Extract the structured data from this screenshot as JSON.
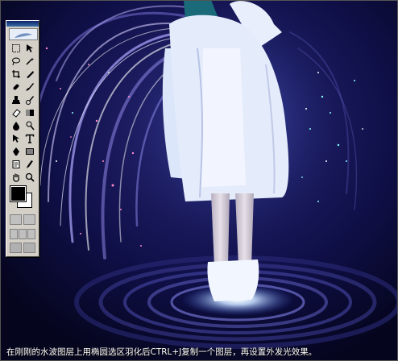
{
  "caption": "在刚刚的水波图层上用椭圆选区羽化后CTRL+J复制一个图层，再设置外发光效果。",
  "toolbox": {
    "tools": [
      "marquee-tool",
      "move-tool",
      "lasso-tool",
      "magic-wand-tool",
      "crop-tool",
      "slice-tool",
      "healing-brush-tool",
      "brush-tool",
      "clone-stamp-tool",
      "history-brush-tool",
      "eraser-tool",
      "gradient-tool",
      "blur-tool",
      "dodge-tool",
      "path-selection-tool",
      "type-tool",
      "pen-tool",
      "shape-tool",
      "notes-tool",
      "eyedropper-tool",
      "hand-tool",
      "zoom-tool"
    ],
    "foreground_color": "#000000",
    "background_color": "#ffffff"
  },
  "colors": {
    "background": "#0a0a2e",
    "glow": "#a8c8ff",
    "coat": "#e8f0ff",
    "ripple": "#3a3a8a"
  }
}
